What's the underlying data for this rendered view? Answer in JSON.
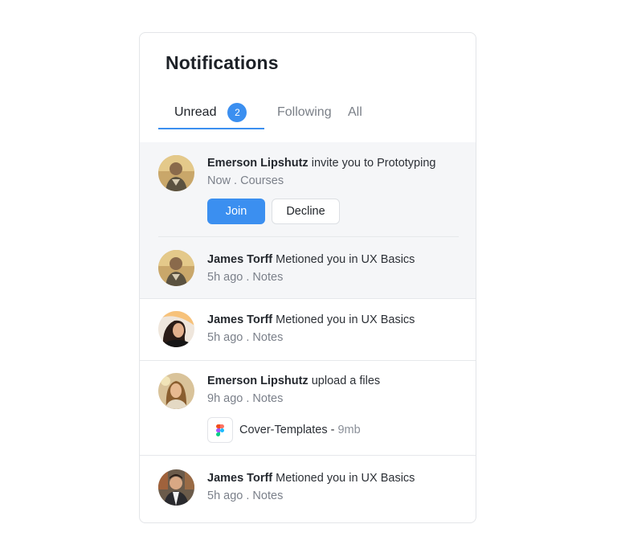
{
  "panel": {
    "title": "Notifications",
    "tabs": [
      {
        "label": "Unread",
        "badge": "2",
        "active": true
      },
      {
        "label": "Following"
      },
      {
        "label": "All"
      }
    ]
  },
  "colors": {
    "accent": "#3b8ff0",
    "unread_bg": "#f5f6f8"
  },
  "notifications": [
    {
      "name": "Emerson Lipshutz",
      "text": " invite you to Prototyping",
      "meta": "Now . Courses",
      "unread": true,
      "actions": {
        "join": "Join",
        "decline": "Decline"
      }
    },
    {
      "name": "James Torff",
      "text": " Metioned you in UX Basics",
      "meta": "5h ago . Notes",
      "unread": true
    },
    {
      "name": "James Torff",
      "text": " Metioned you in UX Basics",
      "meta": "5h ago . Notes",
      "unread": false
    },
    {
      "name": "Emerson Lipshutz",
      "text": " upload a files",
      "meta": "9h ago . Notes",
      "unread": false,
      "file": {
        "name": "Cover-Templates",
        "separator": " - ",
        "size": "9mb",
        "icon": "figma-icon"
      }
    },
    {
      "name": "James Torff",
      "text": " Metioned you in UX Basics",
      "meta": "5h ago . Notes",
      "unread": false
    }
  ]
}
